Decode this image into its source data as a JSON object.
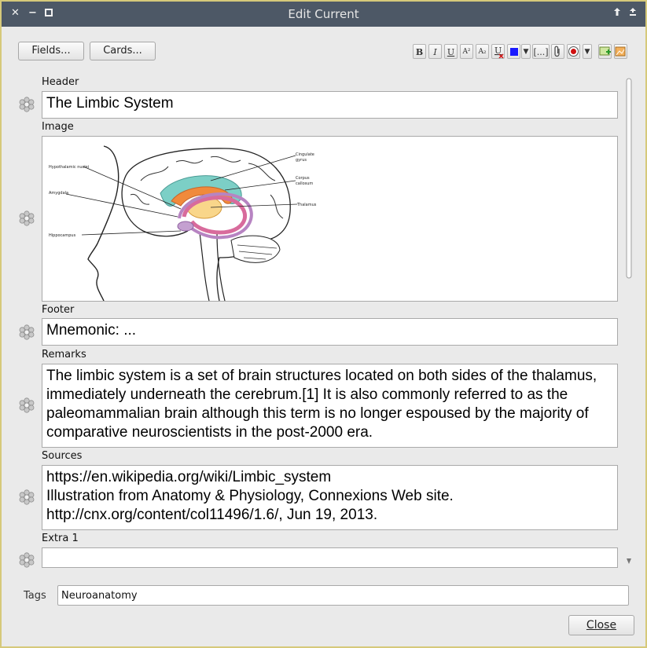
{
  "window": {
    "title": "Edit Current"
  },
  "toolbar": {
    "fields_button": "Fields...",
    "cards_button": "Cards..."
  },
  "format": {
    "bold": "B",
    "italic": "I",
    "underline": "U",
    "superscript": "A²",
    "subscript": "A₂",
    "cloze": "[...]",
    "text_color": "#1a1aff"
  },
  "fields": [
    {
      "name": "Header",
      "value": "The Limbic System"
    },
    {
      "name": "Image",
      "value": ""
    },
    {
      "name": "Footer",
      "value": "Mnemonic: ..."
    },
    {
      "name": "Remarks",
      "value": "The limbic system is a set of brain structures located on both sides of the thalamus, immediately underneath the cerebrum.[1] It is also commonly referred to as the paleomammalian brain although this term is no longer espoused by the majority of comparative neuroscientists in the post-2000 era."
    },
    {
      "name": "Sources",
      "value": "https://en.wikipedia.org/wiki/Limbic_system\nIllustration from Anatomy & Physiology, Connexions Web site.\nhttp://cnx.org/content/col11496/1.6/, Jun 19, 2013."
    },
    {
      "name": "Extra 1",
      "value": ""
    }
  ],
  "diagram_labels": {
    "hypothalamic_nuclei": "Hypothalamic nuclei",
    "amygdala": "Amygdala",
    "hippocampus": "Hippocampus",
    "cingulate_gyrus_1": "Cingulate",
    "cingulate_gyrus_2": "gyrus",
    "corpus_1": "Corpus",
    "corpus_2": "callosum",
    "thalamus": "Thalamus"
  },
  "tags": {
    "label": "Tags",
    "value": "Neuroanatomy"
  },
  "close_button": "Close"
}
